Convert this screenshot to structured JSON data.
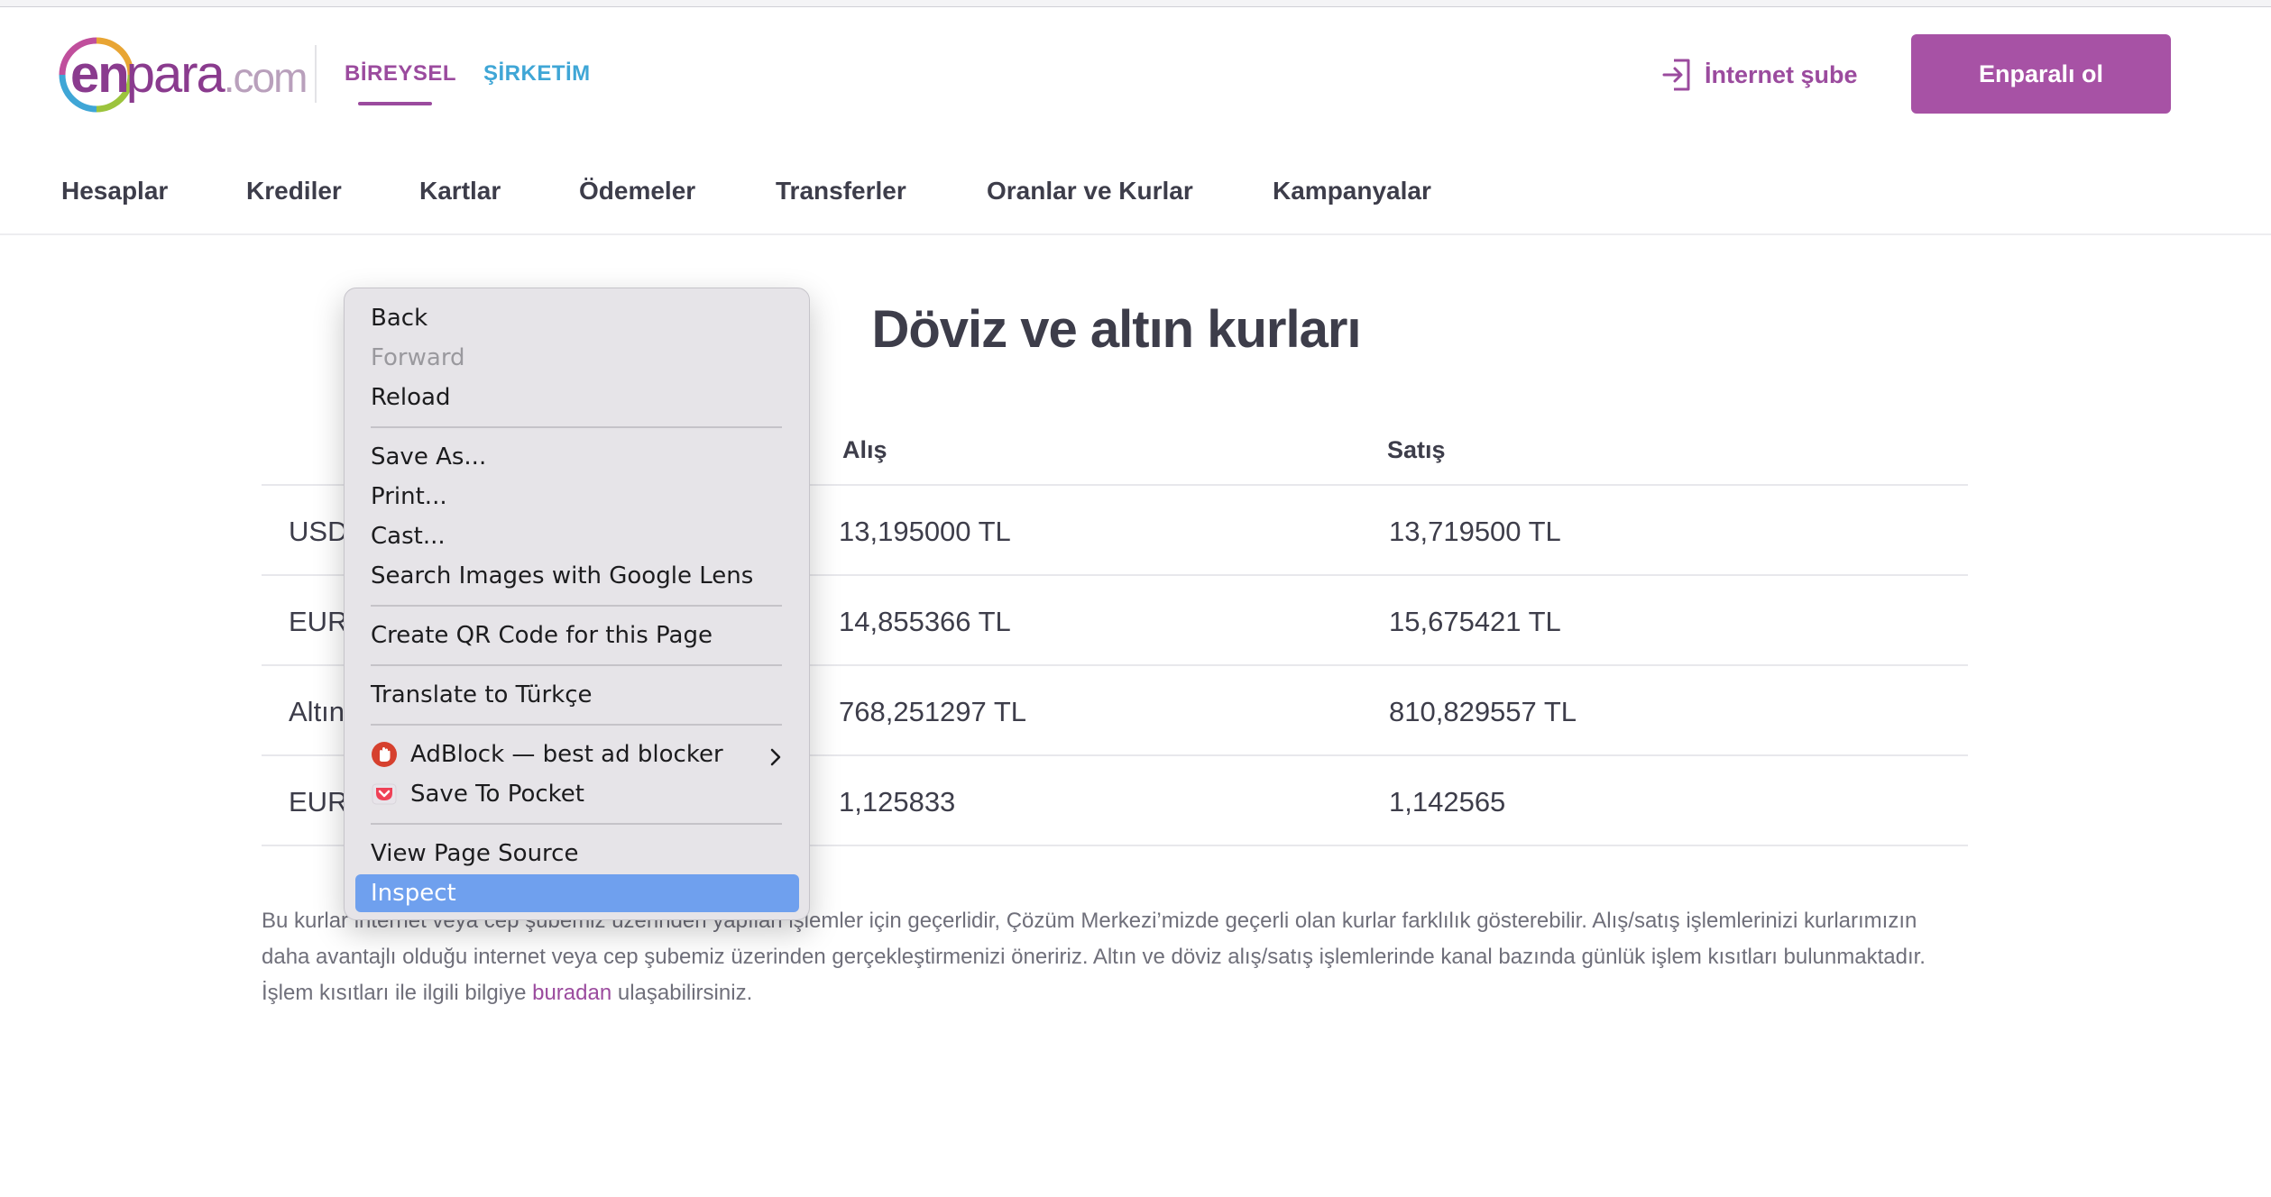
{
  "header": {
    "logo": {
      "en": "en",
      "para": "para",
      "com": ".com"
    },
    "segments": [
      "BİREYSEL",
      "ŞİRKETİM"
    ],
    "login_label": "İnternet şube",
    "cta_label": "Enparalı ol"
  },
  "nav": [
    "Hesaplar",
    "Krediler",
    "Kartlar",
    "Ödemeler",
    "Transferler",
    "Oranlar ve Kurlar",
    "Kampanyalar"
  ],
  "main": {
    "title": "Döviz ve altın kurları",
    "columns": {
      "buy": "Alış",
      "sell": "Satış"
    },
    "rows": [
      {
        "name": "USD",
        "buy": "13,195000 TL",
        "sell": "13,719500 TL"
      },
      {
        "name": "EUR",
        "buy": "14,855366 TL",
        "sell": "15,675421 TL"
      },
      {
        "name": "Altın",
        "buy": "768,251297 TL",
        "sell": "810,829557 TL"
      },
      {
        "name": "EUR",
        "buy": "1,125833",
        "sell": "1,142565"
      }
    ],
    "note_before": "Bu kurlar internet veya cep şubemiz üzerinden yapılan işlemler için geçerlidir, Çözüm Merkezi’mizde geçerli olan kurlar farklılık gösterebilir. Alış/satış işlemlerinizi kurlarımızın daha avantajlı olduğu internet veya cep şubemiz üzerinden gerçekleştirmenizi öneririz. Altın ve döviz alış/satış işlemlerinde kanal bazında günlük işlem kısıtları bulunmaktadır. İşlem kısıtları ile ilgili bilgiye ",
    "note_link": "buradan",
    "note_after": " ulaşabilirsiniz."
  },
  "context_menu": {
    "items": [
      "Back",
      "Forward",
      "Reload",
      "Save As...",
      "Print...",
      "Cast...",
      "Search Images with Google Lens",
      "Create QR Code for this Page",
      "Translate to Türkçe",
      "AdBlock — best ad blocker",
      "Save To Pocket",
      "View Page Source",
      "Inspect"
    ],
    "disabled": [
      "Forward"
    ],
    "highlighted": "Inspect"
  },
  "colors": {
    "brand_purple": "#a752a5",
    "link_blue": "#3fa6d6",
    "menu_highlight": "#6fa0ee"
  }
}
